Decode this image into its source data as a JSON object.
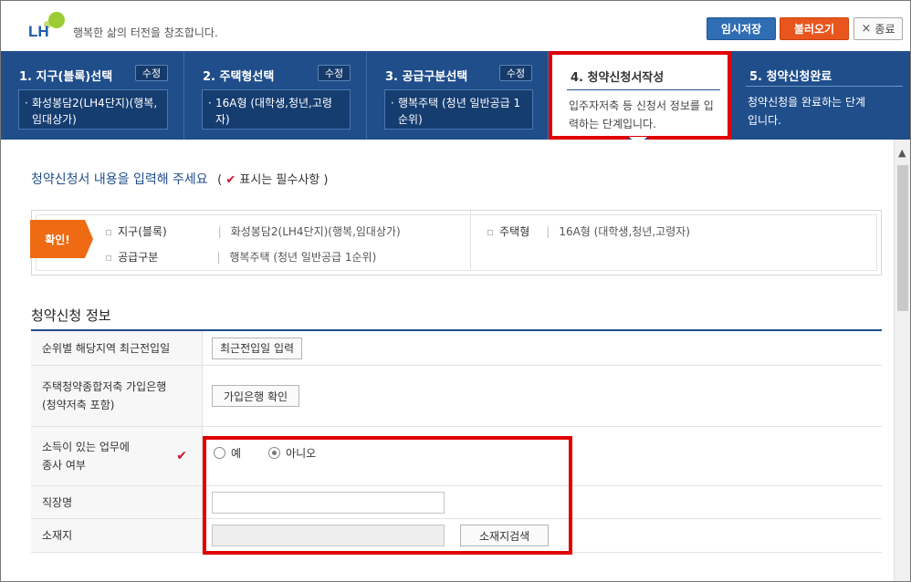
{
  "header": {
    "logo_text": "LH",
    "slogan": "행복한 삶의 터전을 창조합니다.",
    "save_label": "임시저장",
    "load_label": "불러오기",
    "close_label": "종료",
    "close_icon": "×"
  },
  "steps": [
    {
      "title": "1. 지구(블록)선택",
      "edit": "수정",
      "value": "화성봉담2(LH4단지)(행복,임대상가)"
    },
    {
      "title": "2. 주택형선택",
      "edit": "수정",
      "value": "16A형 (대학생,청년,고령자)"
    },
    {
      "title": "3. 공급구분선택",
      "edit": "수정",
      "value": "행복주택 (청년 일반공급 1순위)"
    },
    {
      "title": "4. 청약신청서작성",
      "desc": "입주자저축 등 신청서 정보를 입력하는 단계입니다."
    },
    {
      "title": "5. 청약신청완료",
      "desc": "청약신청을 완료하는 단계입니다."
    }
  ],
  "intro": {
    "text": "청약신청서 내용을 입력해 주세요",
    "req_open": "(",
    "req_mark": "✔",
    "req_text": "표시는 필수사항 )"
  },
  "confirm": {
    "tag": "확인!",
    "items": [
      {
        "label": "지구(블록)",
        "value": "화성봉담2(LH4단지)(행복,임대상가)"
      },
      {
        "label": "공급구분",
        "value": "행복주택 (청년 일반공급 1순위)"
      },
      {
        "label": "주택형",
        "value": "16A형 (대학생,청년,고령자)"
      }
    ]
  },
  "section_title": "청약신청 정보",
  "form": {
    "row1_label": "순위별 해당지역 최근전입일",
    "row1_button": "최근전입일 입력",
    "row2_label_1": "주택청약종합저축 가입은행",
    "row2_label_2": "(청약저축 포함)",
    "row2_button": "가입은행 확인",
    "row3_label_1": "소득이 있는 업무에",
    "row3_label_2": "종사 여부",
    "row3_req": "✔",
    "opt_yes": "예",
    "opt_no": "아니오",
    "selected": "아니오",
    "row4_label": "직장명",
    "row4_value": "",
    "row5_label": "소재지",
    "row5_value": "",
    "row5_button": "소재지검색"
  },
  "scrollbar": {
    "up_icon": "▲"
  }
}
